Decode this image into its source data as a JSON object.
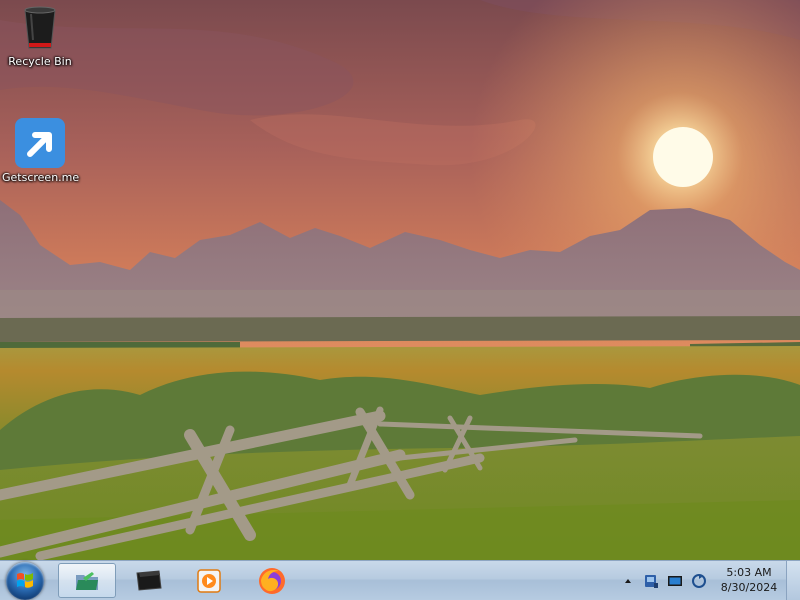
{
  "desktop": {
    "icons": [
      {
        "label": "Recycle Bin",
        "icon": "recycle-bin-icon"
      },
      {
        "label": "Getscreen.me",
        "icon": "shortcut-arrow-icon"
      }
    ]
  },
  "taskbar": {
    "start_icon": "windows-logo-icon",
    "pinned": [
      {
        "name": "file-explorer",
        "icon": "folder-icon",
        "active": true
      },
      {
        "name": "terminal",
        "icon": "terminal-icon",
        "active": false
      },
      {
        "name": "media-player",
        "icon": "media-player-icon",
        "active": false
      },
      {
        "name": "firefox",
        "icon": "firefox-icon",
        "active": false
      }
    ],
    "tray": {
      "icons": [
        "chevron-up-icon",
        "network-icon",
        "display-icon",
        "sync-icon"
      ]
    },
    "clock": {
      "time": "5:03 AM",
      "date": "8/30/2024"
    }
  },
  "colors": {
    "taskbar_bg": "#b7cbe0",
    "shortcut_blue": "#3b8fe0"
  }
}
